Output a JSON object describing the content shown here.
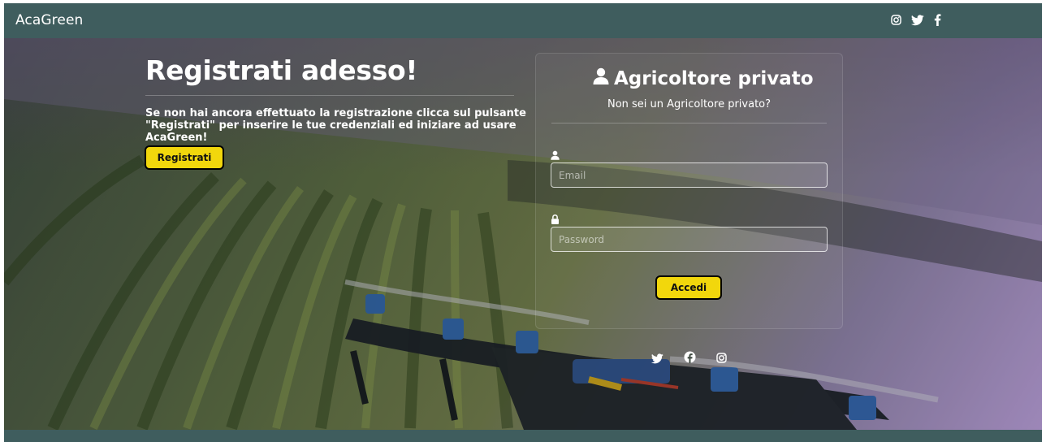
{
  "navbar": {
    "brand": "AcaGreen",
    "icons": [
      "instagram-icon",
      "twitter-icon",
      "facebook-icon"
    ]
  },
  "hero": {
    "title": "Registrati adesso!",
    "text": "Se non hai ancora effettuato la registrazione clicca sul pulsante \"Registrati\" per inserire le tue credenziali ed iniziare ad usare AcaGreen!",
    "register_label": "Registrati"
  },
  "login": {
    "title": "Agricoltore privato",
    "subtitle": "Non sei un Agricoltore privato?",
    "email_placeholder": "Email",
    "password_placeholder": "Password",
    "submit_label": "Accedi"
  },
  "social": [
    "twitter-icon",
    "facebook-icon",
    "instagram-icon"
  ],
  "colors": {
    "navbar": "#3f5d5e",
    "accent": "#f2d70c"
  }
}
